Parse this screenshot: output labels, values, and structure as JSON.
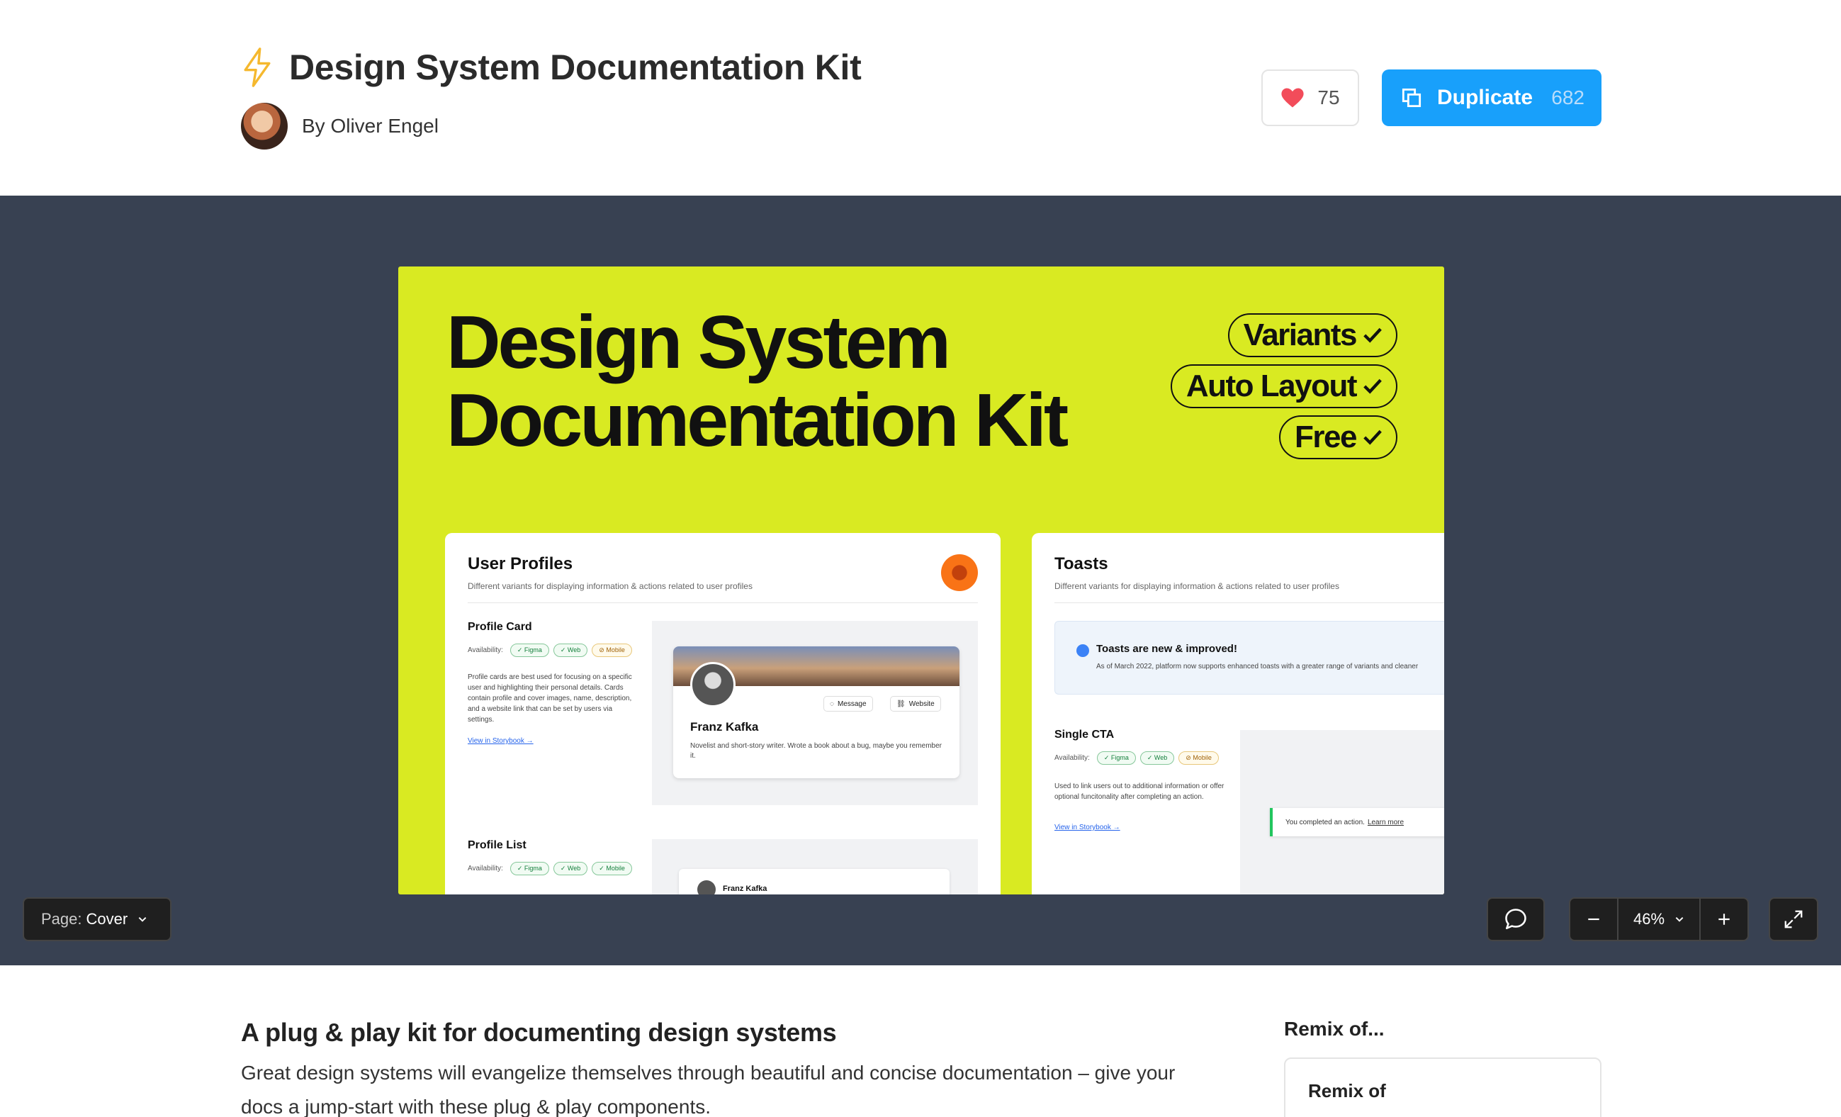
{
  "header": {
    "title": "Design System Documentation Kit",
    "author": "By Oliver Engel",
    "likes": "75",
    "duplicate_label": "Duplicate",
    "duplicate_count": "682",
    "bolt_color": "#f5b82e",
    "accent": "#18a0fb"
  },
  "cover": {
    "title_line1": "Design System",
    "title_line2": "Documentation Kit",
    "tags": [
      "Variants",
      "Auto Layout",
      "Free"
    ],
    "background": "#d9ea22",
    "profiles_card": {
      "heading": "User Profiles",
      "subtitle": "Different variants for displaying information & actions related to user profiles",
      "profile_card": {
        "title": "Profile Card",
        "availability_label": "Availability:",
        "chips": [
          "✓ Figma",
          "✓ Web",
          "⊘ Mobile"
        ],
        "description": "Profile cards are best used for focusing on a specific user and highlighting their personal details. Cards contain profile and cover images, name, description, and a website link that can be set by users via settings.",
        "link": "View in Storybook →",
        "demo_message": "Message",
        "demo_website": "Website",
        "demo_name": "Franz Kafka",
        "demo_bio": "Novelist and short-story writer. Wrote a book about a bug, maybe you remember it."
      },
      "profile_list": {
        "title": "Profile List",
        "availability_label": "Availability:",
        "chips": [
          "✓ Figma",
          "✓ Web",
          "✓ Mobile"
        ],
        "demo_name": "Franz Kafka"
      }
    },
    "toasts_card": {
      "heading": "Toasts",
      "subtitle": "Different variants for displaying information & actions related to user profiles",
      "banner_title": "Toasts are new & improved!",
      "banner_text": "As of March 2022, platform now supports enhanced toasts with a greater range of variants and cleaner",
      "single_cta": {
        "title": "Single CTA",
        "availability_label": "Availability:",
        "chips": [
          "✓ Figma",
          "✓ Web",
          "⊘ Mobile"
        ],
        "description": "Used to link users out to additional information or offer optional funcitonality after completing an action.",
        "link": "View in Storybook →",
        "toast_text": "You completed an action.",
        "toast_link": "Learn more"
      }
    }
  },
  "viewer": {
    "page_label": "Page:",
    "page_value": "Cover",
    "zoom": "46%",
    "icons": [
      "comment-icon",
      "zoom-out-icon",
      "chevron-down-icon",
      "zoom-in-icon",
      "expand-icon"
    ]
  },
  "description": {
    "heading": "A plug & play kit for documenting design systems",
    "text": "Great design systems will evangelize themselves through beautiful and concise documentation – give your docs a jump-start with these plug & play components."
  },
  "remix": {
    "heading": "Remix of...",
    "card_label": "Remix of"
  }
}
